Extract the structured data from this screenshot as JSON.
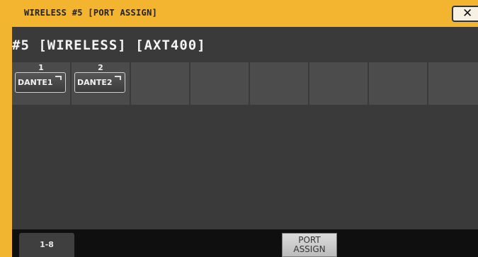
{
  "window": {
    "title": "WIRELESS #5 [PORT ASSIGN]",
    "close_glyph": "✕"
  },
  "header": {
    "channel_label": "#5 [WIRELESS]  [AXT400]"
  },
  "slots": [
    {
      "number": "1",
      "button_label": "DANTE1"
    },
    {
      "number": "2",
      "button_label": "DANTE2"
    },
    {
      "number": "",
      "button_label": ""
    },
    {
      "number": "",
      "button_label": ""
    },
    {
      "number": "",
      "button_label": ""
    },
    {
      "number": "",
      "button_label": ""
    },
    {
      "number": "",
      "button_label": ""
    },
    {
      "number": "",
      "button_label": ""
    }
  ],
  "footer": {
    "page_tab": "1-8",
    "port_assign_line1": "PORT",
    "port_assign_line2": "ASSIGN"
  },
  "colors": {
    "title_bar": "#f3b430",
    "panel": "#3a3a3a",
    "footer": "#0f0f0f"
  },
  "icons": {
    "close": "close-icon"
  }
}
